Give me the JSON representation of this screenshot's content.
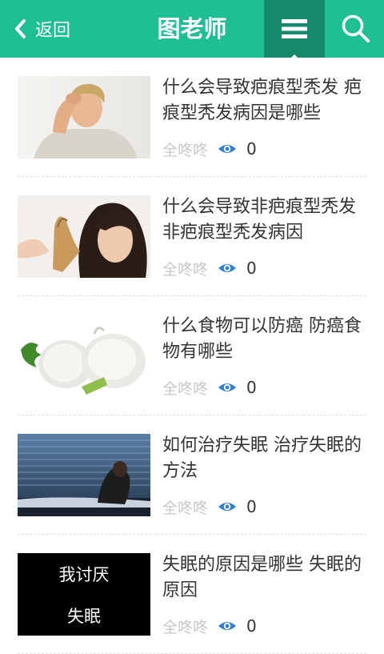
{
  "header": {
    "back_label": "返回",
    "title": "图老师",
    "menu_icon": "menu-icon",
    "search_icon": "search-icon",
    "brand_color": "#1fbf96",
    "active_color": "#168a6b"
  },
  "articles": [
    {
      "title": "什么会导致疤痕型秃发 疤痕型秃发病因是哪些",
      "author": "全咚咚",
      "views": "0",
      "thumb": "man-holding-head-photo"
    },
    {
      "title": "什么会导致非疤痕型秃发 非疤痕型秃发病因",
      "author": "全咚咚",
      "views": "0",
      "thumb": "woman-with-hair-comb-photo"
    },
    {
      "title": "什么食物可以防癌 防癌食物有哪些",
      "author": "全咚咚",
      "views": "0",
      "thumb": "garlic-photo"
    },
    {
      "title": "如何治疗失眠 治疗失眠的方法",
      "author": "全咚咚",
      "views": "0",
      "thumb": "man-sitting-on-bed-photo"
    },
    {
      "title": "失眠的原因是哪些 失眠的原因",
      "author": "全咚咚",
      "views": "0",
      "thumb": "insomnia-text-image",
      "thumb_text_line1": "我讨厌",
      "thumb_text_line2": "失眠"
    }
  ]
}
